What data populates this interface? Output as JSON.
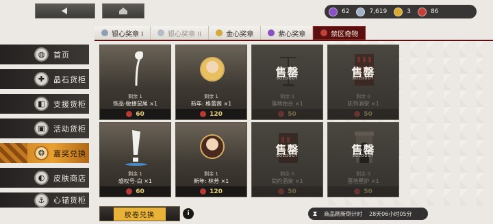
{
  "topbar": {
    "back_icon": "back-arrow-icon",
    "home_icon": "home-icon",
    "currencies": [
      {
        "icon": "purple-orb-icon",
        "color": "#8a4fc0",
        "value": "62"
      },
      {
        "icon": "diamond-icon",
        "color": "#9fb2c6",
        "value": "7,619"
      },
      {
        "icon": "gold-coin-icon",
        "color": "#d8aa30",
        "value": "3"
      },
      {
        "icon": "red-orb-icon",
        "color": "#c0403a",
        "value": "86"
      }
    ]
  },
  "tabs": [
    {
      "label": "银心奖章 I",
      "color": "#8fa0b4",
      "state": "normal"
    },
    {
      "label": "银心奖章 II",
      "color": "#b4bcc4",
      "state": "disabled"
    },
    {
      "label": "金心奖章",
      "color": "#d4aa3c",
      "state": "normal"
    },
    {
      "label": "紫心奖章",
      "color": "#8a4fc0",
      "state": "normal"
    },
    {
      "label": "禁区奇物",
      "color": "#c0403a",
      "state": "active"
    }
  ],
  "sidebar": {
    "items": [
      {
        "label": "首页",
        "icon": "shop-bag-icon",
        "glyph": "◍"
      },
      {
        "label": "晶石货柜",
        "icon": "crystal-icon",
        "glyph": "✚"
      },
      {
        "label": "支援货柜",
        "icon": "support-icon",
        "glyph": "◧"
      },
      {
        "label": "活动货柜",
        "icon": "event-chest-icon",
        "glyph": "▣"
      },
      {
        "label": "嘉奖兑换",
        "icon": "medal-icon",
        "glyph": "❂"
      },
      {
        "label": "皮肤商店",
        "icon": "skin-icon",
        "glyph": "◐"
      },
      {
        "label": "心锚货柜",
        "icon": "anchor-icon",
        "glyph": "⚓"
      }
    ]
  },
  "items": [
    {
      "stock": "剩余 1",
      "name": "饰品-敏捷鼠尾 ×1",
      "price": "60",
      "sold_out": false,
      "thumb": "tail-accessory"
    },
    {
      "stock": "剩余 1",
      "name": "新年: 格蕾茜 ×1",
      "price": "120",
      "sold_out": false,
      "thumb": "portrait-blonde"
    },
    {
      "stock": "剩余 0",
      "name": "落地烛台 ×1",
      "price": "50",
      "sold_out": true,
      "thumb": "candelabra"
    },
    {
      "stock": "剩余 0",
      "name": "陈列酒架 ×1",
      "price": "50",
      "sold_out": true,
      "thumb": "wine-rack"
    },
    {
      "stock": "剩余 1",
      "name": "感叹号-白 ×1",
      "price": "60",
      "sold_out": false,
      "thumb": "exclamation"
    },
    {
      "stock": "剩余 1",
      "name": "新年: 林芳 ×1",
      "price": "120",
      "sold_out": false,
      "thumb": "portrait-dark"
    },
    {
      "stock": "剩余 0",
      "name": "简约酒架 ×1",
      "price": "50",
      "sold_out": true,
      "thumb": "simple-rack"
    },
    {
      "stock": "剩余 0",
      "name": "落地壁炉 ×1",
      "price": "50",
      "sold_out": true,
      "thumb": "fireplace"
    }
  ],
  "soldout": {
    "text": "售罄",
    "sub": "SOLDOUT"
  },
  "bottom": {
    "exchange_label": "胶卷兑换",
    "info": "i",
    "refresh_label": "商品刷新倒计时",
    "refresh_time": "28天06小时05分"
  },
  "colors": {
    "accent": "#5a1010",
    "gold": "#e8b338"
  }
}
